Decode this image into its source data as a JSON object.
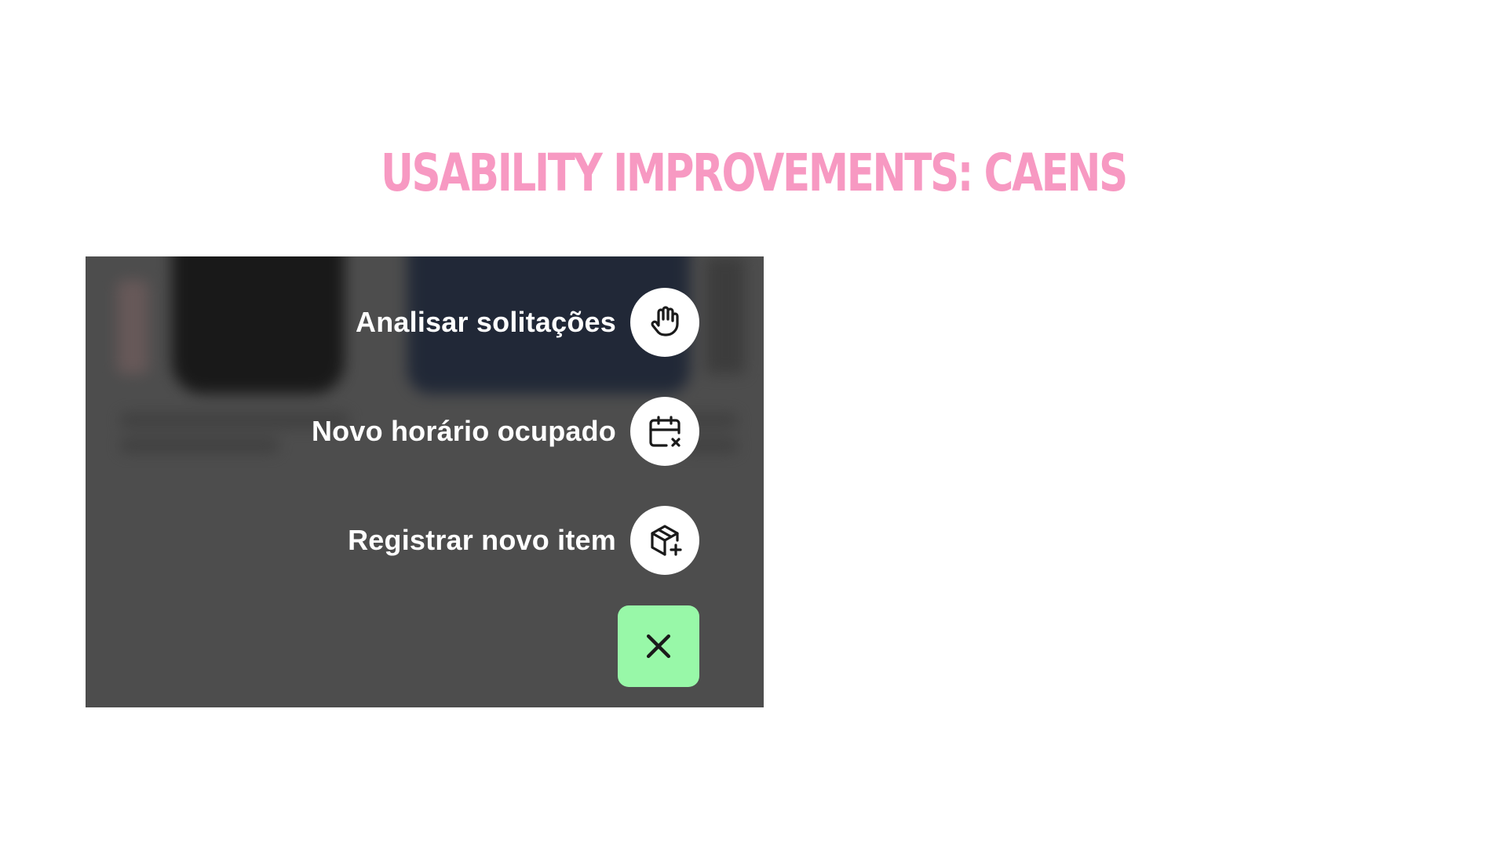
{
  "slide": {
    "title": "USABILITY IMPROVEMENTS: CAENS",
    "title_color": "#f799c2"
  },
  "menu": {
    "actions": [
      {
        "label": "Analisar solitações",
        "icon": "hand-icon"
      },
      {
        "label": "Novo horário ocupado",
        "icon": "calendar-x-icon"
      },
      {
        "label": "Registrar novo item",
        "icon": "package-plus-icon"
      }
    ],
    "close_icon": "close-icon",
    "close_color": "#98f8a8",
    "overlay_color": "#4d4d4d"
  }
}
